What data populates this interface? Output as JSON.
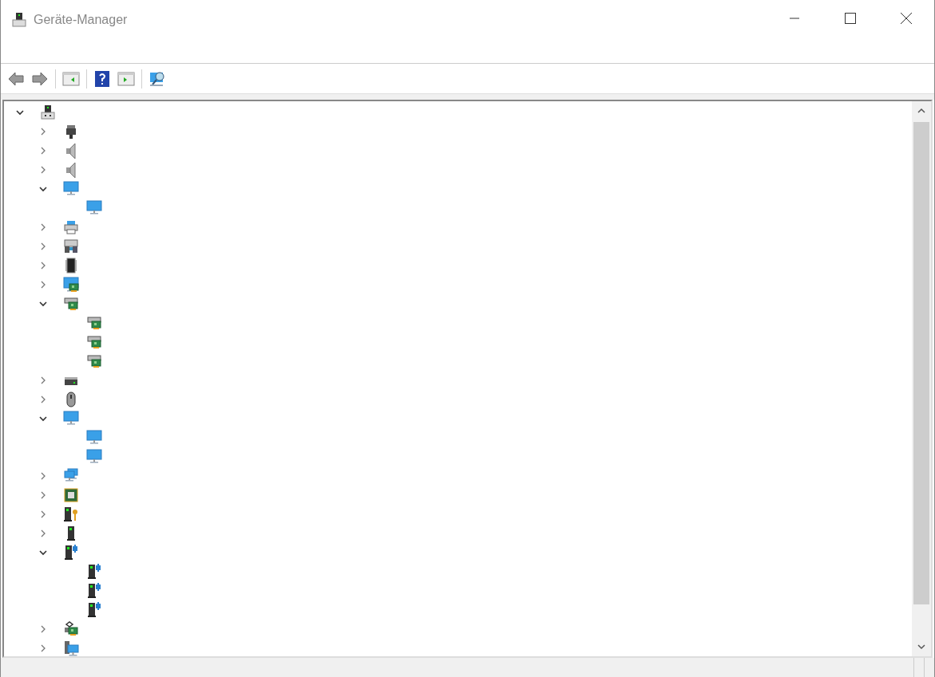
{
  "window": {
    "title": "Geräte-Manager"
  },
  "toolbar": [
    {
      "kind": "back"
    },
    {
      "kind": "forward"
    },
    {
      "kind": "separator"
    },
    {
      "kind": "tree-pane"
    },
    {
      "kind": "separator"
    },
    {
      "kind": "help"
    },
    {
      "kind": "detail-pane"
    },
    {
      "kind": "separator"
    },
    {
      "kind": "scan"
    }
  ],
  "tree": [
    {
      "kind": "computer",
      "expanded": true,
      "children": [
        {
          "kind": "connector",
          "expanded": false
        },
        {
          "kind": "speaker",
          "expanded": false
        },
        {
          "kind": "speaker",
          "expanded": false
        },
        {
          "kind": "monitor",
          "expanded": true,
          "children": [
            {
              "kind": "monitor"
            }
          ]
        },
        {
          "kind": "printer",
          "expanded": false
        },
        {
          "kind": "keyboard",
          "expanded": false
        },
        {
          "kind": "chip",
          "expanded": false
        },
        {
          "kind": "display-card",
          "expanded": false
        },
        {
          "kind": "card",
          "expanded": true,
          "children": [
            {
              "kind": "card"
            },
            {
              "kind": "card"
            },
            {
              "kind": "card"
            }
          ]
        },
        {
          "kind": "drive",
          "expanded": false
        },
        {
          "kind": "mouse",
          "expanded": false
        },
        {
          "kind": "monitor",
          "expanded": true,
          "children": [
            {
              "kind": "monitor"
            },
            {
              "kind": "monitor"
            }
          ]
        },
        {
          "kind": "network",
          "expanded": false
        },
        {
          "kind": "processor",
          "expanded": false
        },
        {
          "kind": "security",
          "expanded": false
        },
        {
          "kind": "tower",
          "expanded": false
        },
        {
          "kind": "tower-plugin",
          "expanded": true,
          "children": [
            {
              "kind": "tower-plugin"
            },
            {
              "kind": "tower-plugin"
            },
            {
              "kind": "tower-plugin"
            }
          ]
        },
        {
          "kind": "controller",
          "expanded": false
        },
        {
          "kind": "system",
          "expanded": false
        }
      ]
    }
  ]
}
